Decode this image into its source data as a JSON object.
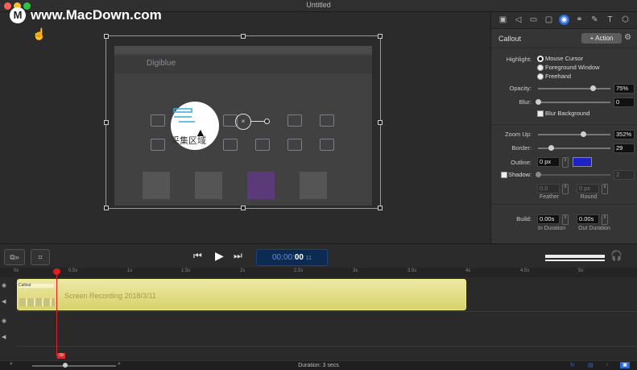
{
  "window": {
    "title": "Untitled"
  },
  "watermark": {
    "text": "www.MacDown.com",
    "logo": "M"
  },
  "canvas": {
    "recording_nav_text": "Digiblue",
    "callout_text": "采集区域",
    "center_handle_glyph": "×"
  },
  "inspector": {
    "tabs": [
      "video-icon",
      "audio-icon",
      "display-icon",
      "screen-icon",
      "callout-icon",
      "touch-icon",
      "annotation-icon",
      "text-icon",
      "shape-icon"
    ],
    "title": "Callout",
    "action_button": "+ Action",
    "gear": "⚙",
    "highlight": {
      "label": "Highlight:",
      "options": [
        "Mouse Cursor",
        "Foreground Window",
        "Freehand"
      ],
      "selected": "Mouse Cursor"
    },
    "opacity": {
      "label": "Opacity:",
      "value": "75%",
      "level": 0.75
    },
    "blur": {
      "label": "Blur:",
      "value": "0",
      "level": 0
    },
    "blur_background": {
      "label": "Blur Background",
      "checked": false
    },
    "zoom_up": {
      "label": "Zoom Up:",
      "value": "352%",
      "level": 0.62
    },
    "border": {
      "label": "Border:",
      "value": "29",
      "level": 0.18
    },
    "outline": {
      "label": "Outline:",
      "value": "0 px",
      "color": "#1a22c8"
    },
    "shadow": {
      "label": "Shadow:",
      "value": "2",
      "checked": false,
      "level": 0
    },
    "feather": {
      "label": "Feather",
      "value": "0.0"
    },
    "round": {
      "label": "Round",
      "value": "0 px"
    },
    "build": {
      "label": "Build:",
      "in": {
        "label": "In Duration",
        "value": "0.00s"
      },
      "out": {
        "label": "Out Duration",
        "value": "0.00s"
      }
    }
  },
  "transport": {
    "timecode_prefix": "00:00:",
    "timecode_seconds": "00",
    "timecode_frames": "11"
  },
  "timeline": {
    "ticks": [
      "0s",
      "0.5s",
      "1s",
      "1.5s",
      "2s",
      "2.5s",
      "3s",
      "3.5s",
      "4s",
      "4.5s",
      "5s"
    ],
    "clip_title": "Screen Recording 2018/3/11",
    "callout_tag": "Callout",
    "playhead_label": "00"
  },
  "status": {
    "duration": "Duration: 3 secs"
  },
  "colors": {
    "accent": "#2e6ad6",
    "clip": "#e3de85",
    "playhead": "#e02020"
  }
}
